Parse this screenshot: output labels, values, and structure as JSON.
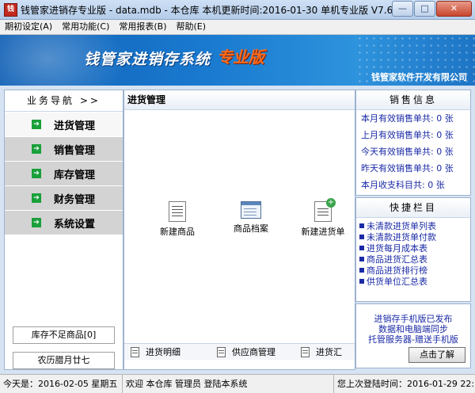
{
  "window": {
    "title": "钱管家进销存专业版 - data.mdb - 本仓库  本机更新时间:2016-01-30 单机专业版 V7.65",
    "icon_text": "钱",
    "minimize": "—",
    "maximize": "□",
    "close": "✕"
  },
  "menu": [
    "期初设定(A)",
    "常用功能(C)",
    "常用报表(B)",
    "帮助(E)"
  ],
  "banner": {
    "title": "钱管家进销存系统",
    "edition": "专业版",
    "company": "钱管家软件开发有限公司"
  },
  "nav": {
    "header": "业务导航 >>",
    "items": [
      {
        "label": "进货管理",
        "active": true
      },
      {
        "label": "销售管理",
        "active": false
      },
      {
        "label": "库存管理",
        "active": false
      },
      {
        "label": "财务管理",
        "active": false
      },
      {
        "label": "系统设置",
        "active": false
      }
    ],
    "low_stock": "库存不足商品[0]",
    "lunar_date": "农历腊月廿七"
  },
  "center": {
    "title": "进货管理",
    "quick": [
      {
        "label": "新建商品",
        "icon": "document-icon"
      },
      {
        "label": "商品档案",
        "icon": "window-icon"
      },
      {
        "label": "新建进货单",
        "icon": "new-document-icon"
      }
    ],
    "tabs": [
      "进货明细",
      "供应商管理",
      "进货汇"
    ]
  },
  "sales": {
    "header": "销售信息",
    "lines": [
      "本月有效销售单共: 0 张",
      "上月有效销售单共: 0 张",
      "今天有效销售单共: 0 张",
      "昨天有效销售单共: 0 张",
      "本月收支科目共: 0 张"
    ]
  },
  "shortcuts": {
    "header": "快捷栏目",
    "links": [
      "未清款进货单列表",
      "未清款进货单付款",
      "进货每月成本表",
      "商品进货汇总表",
      "商品进货排行榜",
      "供货单位汇总表"
    ]
  },
  "promo": {
    "lines": [
      "进销存手机版已发布",
      "数据和电脑端同步",
      "托管服务器-赠送手机版"
    ],
    "button": "点击了解"
  },
  "status": {
    "today": "今天是：2016-02-05  星期五",
    "welcome": "欢迎  本仓库  管理员  登陆本系统",
    "last_login": "您上次登陆时间：2016-01-29 22:"
  },
  "colors": {
    "link": "#1a2aa6",
    "banner": "#1a7bd0",
    "nav_arrow": "#19a03a",
    "edition": "#ff6a1a"
  }
}
